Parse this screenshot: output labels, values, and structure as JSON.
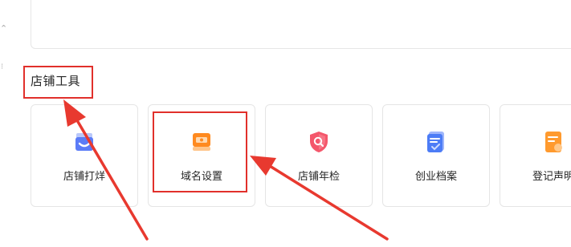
{
  "section": {
    "title": "店铺工具"
  },
  "tools": [
    {
      "label": "店铺打烊",
      "icon": "store-close-icon",
      "color": "#5b7cf7"
    },
    {
      "label": "域名设置",
      "icon": "domain-settings-icon",
      "color": "#ff8a1f"
    },
    {
      "label": "店铺年检",
      "icon": "annual-inspection-shield-icon",
      "color": "#f4576b"
    },
    {
      "label": "创业档案",
      "icon": "entrepreneur-archive-icon",
      "color": "#4c7cf6"
    },
    {
      "label": "登记声明",
      "icon": "registration-statement-icon",
      "color": "#ff9a2e"
    }
  ],
  "annotations": {
    "highlight_color": "#e1302b"
  }
}
